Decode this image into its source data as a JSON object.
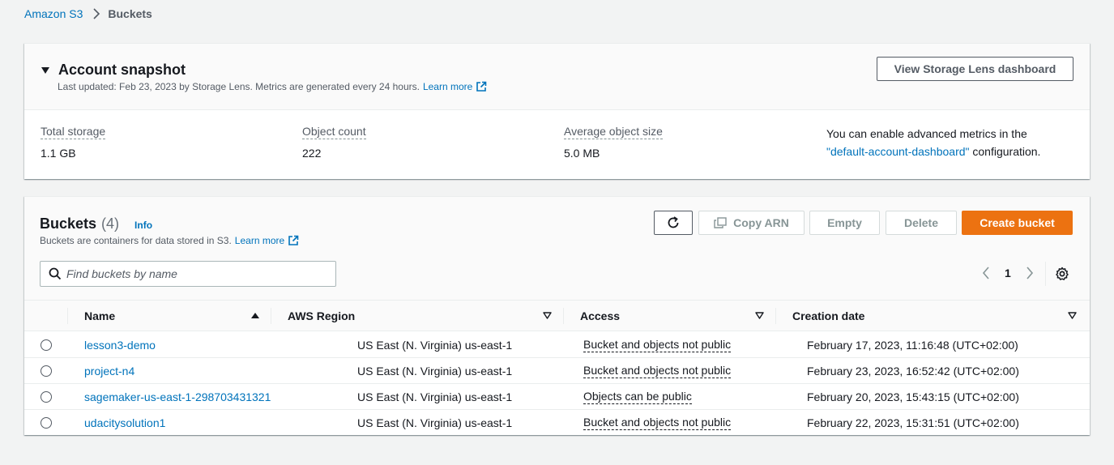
{
  "breadcrumb": {
    "root": "Amazon S3",
    "current": "Buckets"
  },
  "snapshot": {
    "title": "Account snapshot",
    "subtitle": "Last updated: Feb 23, 2023 by Storage Lens. Metrics are generated every 24 hours.",
    "learn_more": "Learn more",
    "lens_button": "View Storage Lens dashboard",
    "metrics": [
      {
        "label": "Total storage",
        "value": "1.1 GB"
      },
      {
        "label": "Object count",
        "value": "222"
      },
      {
        "label": "Average object size",
        "value": "5.0 MB"
      }
    ],
    "note_prefix": "You can enable advanced metrics in the",
    "note_link": "\"default-account-dashboard\"",
    "note_suffix": "configuration."
  },
  "buckets": {
    "title": "Buckets",
    "count": "(4)",
    "info": "Info",
    "subtitle": "Buckets are containers for data stored in S3.",
    "learn_more": "Learn more",
    "actions": {
      "copy_arn": "Copy ARN",
      "empty": "Empty",
      "delete": "Delete",
      "create": "Create bucket"
    },
    "search_placeholder": "Find buckets by name",
    "page": "1",
    "columns": {
      "name": "Name",
      "region": "AWS Region",
      "access": "Access",
      "created": "Creation date"
    },
    "rows": [
      {
        "name": "lesson3-demo",
        "region": "US East (N. Virginia) us-east-1",
        "access": "Bucket and objects not public",
        "created": "February 17, 2023, 11:16:48 (UTC+02:00)"
      },
      {
        "name": "project-n4",
        "region": "US East (N. Virginia) us-east-1",
        "access": "Bucket and objects not public",
        "created": "February 23, 2023, 16:52:42 (UTC+02:00)"
      },
      {
        "name": "sagemaker-us-east-1-298703431321",
        "region": "US East (N. Virginia) us-east-1",
        "access": "Objects can be public",
        "created": "February 20, 2023, 15:43:15 (UTC+02:00)"
      },
      {
        "name": "udacitysolution1",
        "region": "US East (N. Virginia) us-east-1",
        "access": "Bucket and objects not public",
        "created": "February 22, 2023, 15:31:51 (UTC+02:00)"
      }
    ]
  },
  "colors": {
    "link": "#0073bb",
    "primary": "#ec7211",
    "text": "#16191f",
    "muted": "#545b64"
  }
}
